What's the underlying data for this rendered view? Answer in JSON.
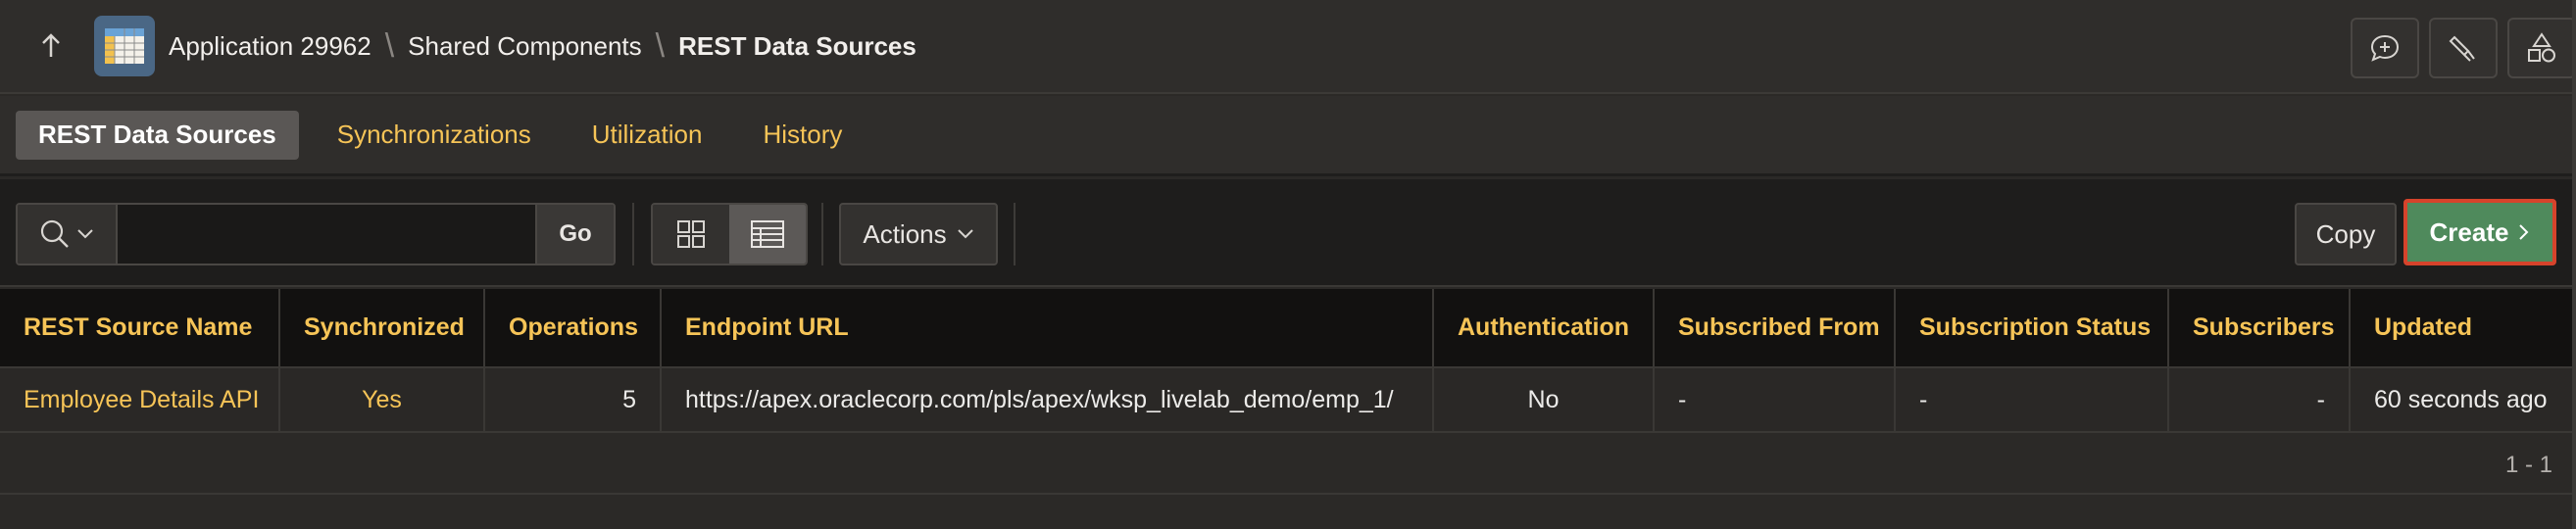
{
  "breadcrumb": {
    "up_icon": "arrow-up-icon",
    "app_icon": "table-grid-icon",
    "items": [
      "Application 29962",
      "Shared Components",
      "REST Data Sources"
    ]
  },
  "top_actions": [
    {
      "icon": "comment-add-icon"
    },
    {
      "icon": "highlighter-icon"
    },
    {
      "icon": "shapes-icon"
    }
  ],
  "tabs": [
    {
      "label": "REST Data Sources",
      "active": true
    },
    {
      "label": "Synchronizations",
      "active": false
    },
    {
      "label": "Utilization",
      "active": false
    },
    {
      "label": "History",
      "active": false
    }
  ],
  "toolbar": {
    "search_value": "",
    "go_label": "Go",
    "actions_label": "Actions",
    "copy_label": "Copy",
    "create_label": "Create"
  },
  "table": {
    "columns": [
      "REST Source Name",
      "Synchronized",
      "Operations",
      "Endpoint URL",
      "Authentication",
      "Subscribed From",
      "Subscription Status",
      "Subscribers",
      "Updated"
    ],
    "rows": [
      [
        "Employee Details API",
        "Yes",
        "5",
        "https://apex.oraclecorp.com/pls/apex/wksp_livelab_demo/emp_1/",
        "No",
        "-",
        "-",
        "-",
        "60 seconds ago"
      ]
    ]
  },
  "pagination": "1 - 1",
  "colors": {
    "accent_yellow": "#f6c457",
    "create_green": "#4f8a5c",
    "create_border_red": "#d6432b"
  }
}
